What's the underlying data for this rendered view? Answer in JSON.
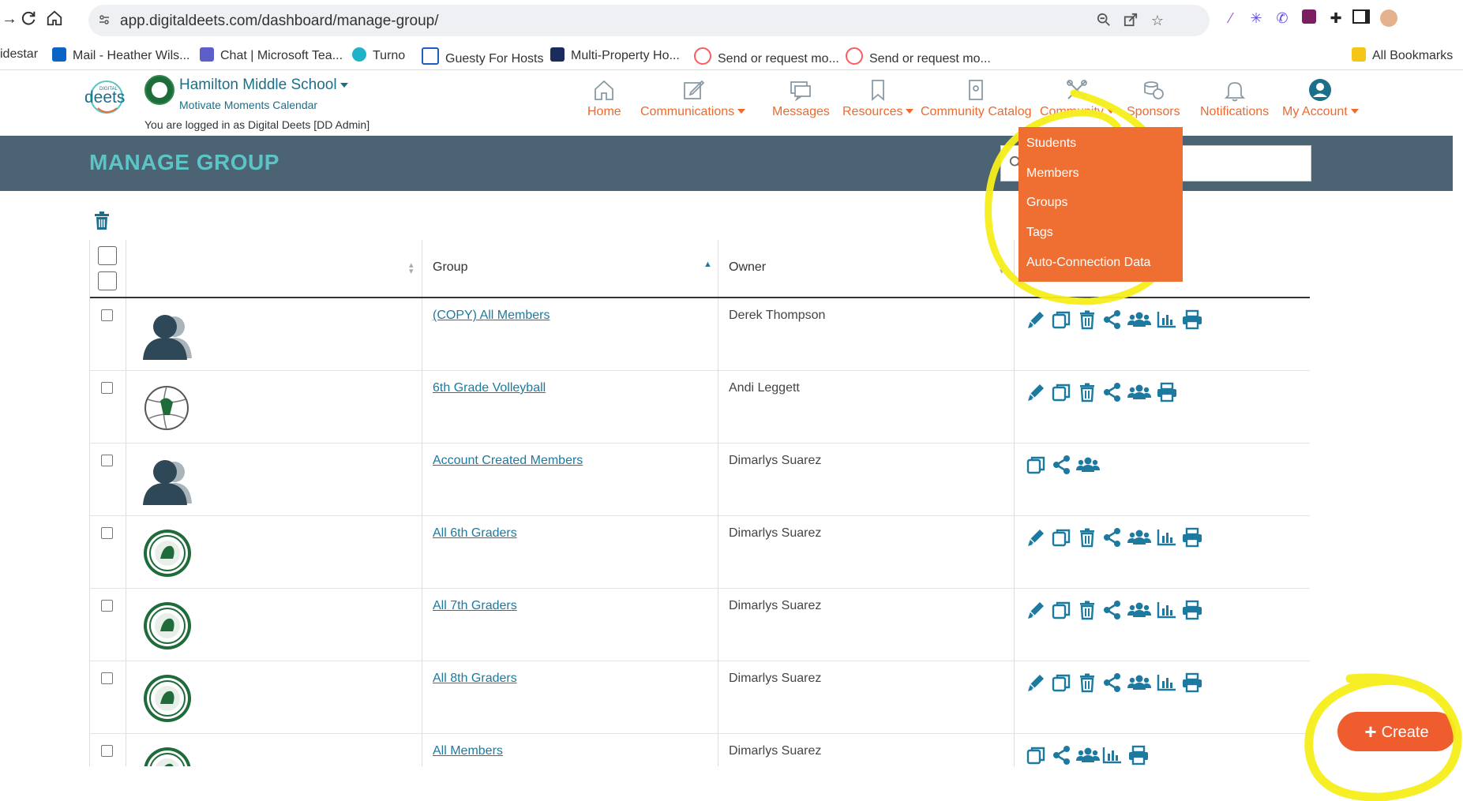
{
  "browser": {
    "url": "app.digitaldeets.com/dashboard/manage-group/",
    "bookmarks": [
      {
        "label": "idestar",
        "color": "#ffffff"
      },
      {
        "label": "Mail - Heather Wils...",
        "color": "#0a64c8"
      },
      {
        "label": "Chat | Microsoft Tea...",
        "color": "#5b5fc7"
      },
      {
        "label": "Turno",
        "color": "#20b3c8"
      },
      {
        "label": "Guesty For Hosts",
        "color": "#1d5fbf"
      },
      {
        "label": "Multi-Property Ho...",
        "color": "#1a2c5e"
      },
      {
        "label": "Send or request mo...",
        "color": "#ff5a5f"
      },
      {
        "label": "Send or request mo...",
        "color": "#ff5a5f"
      }
    ],
    "all_bookmarks": "All Bookmarks"
  },
  "header": {
    "school_name": "Hamilton Middle School",
    "school_sub": "Motivate Moments Calendar",
    "logged_in": "You are logged in as Digital Deets [DD Admin]",
    "logo_text": "deets",
    "logo_small": "DIGITAL",
    "nav": [
      {
        "label": "Home",
        "icon": "home-icon",
        "dropdown": false
      },
      {
        "label": "Communications",
        "icon": "edit-icon",
        "dropdown": true
      },
      {
        "label": "Messages",
        "icon": "messages-icon",
        "dropdown": false
      },
      {
        "label": "Resources",
        "icon": "bookmark-icon",
        "dropdown": true
      },
      {
        "label": "Community Catalog",
        "icon": "catalog-icon",
        "dropdown": false
      },
      {
        "label": "Community",
        "icon": "tools-icon",
        "dropdown": true
      },
      {
        "label": "Sponsors",
        "icon": "sponsors-icon",
        "dropdown": false
      },
      {
        "label": "Notifications",
        "icon": "bell-icon",
        "dropdown": false
      },
      {
        "label": "My Account",
        "icon": "account-icon",
        "dropdown": true
      }
    ]
  },
  "page": {
    "title": "MANAGE GROUP"
  },
  "dropdown": {
    "items": [
      "Students",
      "Members",
      "Groups",
      "Tags",
      "Auto-Connection Data"
    ]
  },
  "table": {
    "headers": {
      "group": "Group",
      "owner": "Owner"
    },
    "rows": [
      {
        "group": "(COPY) All Members",
        "owner": "Derek Thompson",
        "avatar": "person-placeholder",
        "actions": [
          "edit",
          "copy",
          "delete",
          "share",
          "members",
          "stats",
          "print"
        ]
      },
      {
        "group": "6th Grade Volleyball",
        "owner": "Andi Leggett",
        "avatar": "volleyball-logo",
        "actions": [
          "edit",
          "copy",
          "delete",
          "share",
          "members",
          "print"
        ]
      },
      {
        "group": "Account Created Members",
        "owner": "Dimarlys Suarez",
        "avatar": "person-placeholder",
        "actions": [
          "copy",
          "share",
          "members"
        ]
      },
      {
        "group": "All 6th Graders",
        "owner": "Dimarlys Suarez",
        "avatar": "school-seal",
        "actions": [
          "edit",
          "copy",
          "delete",
          "share",
          "members",
          "stats",
          "print"
        ]
      },
      {
        "group": "All 7th Graders",
        "owner": "Dimarlys Suarez",
        "avatar": "school-seal",
        "actions": [
          "edit",
          "copy",
          "delete",
          "share",
          "members",
          "stats",
          "print"
        ]
      },
      {
        "group": "All 8th Graders",
        "owner": "Dimarlys Suarez",
        "avatar": "school-seal",
        "actions": [
          "edit",
          "copy",
          "delete",
          "share",
          "members",
          "stats",
          "print"
        ]
      },
      {
        "group": "All Members",
        "owner": "Dimarlys Suarez",
        "avatar": "school-seal",
        "actions": [
          "copy",
          "share",
          "members",
          "stats",
          "print"
        ]
      }
    ]
  },
  "create_button": {
    "label": "Create"
  },
  "colors": {
    "accent_orange": "#ef6f33",
    "link_teal": "#1c7aa0",
    "title_band": "#4c6373",
    "title_text": "#5bc4c7",
    "highlight_yellow": "#f5ee1a"
  }
}
